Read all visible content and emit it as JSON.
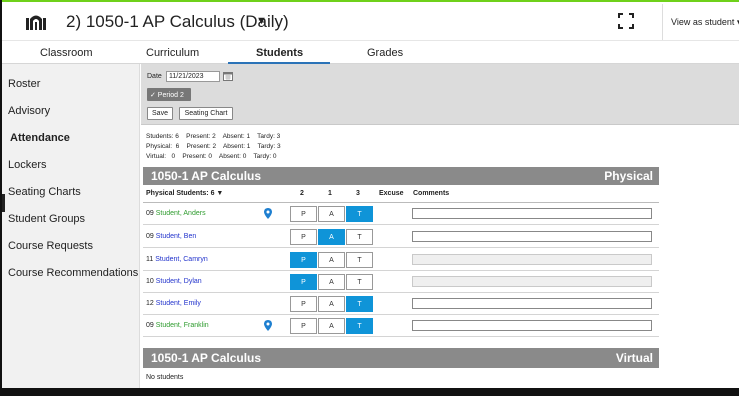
{
  "header": {
    "title": "2) 1050-1 AP Calculus (Daily)",
    "view_as": "View as student",
    "icons": {
      "logo": "campus-logo-icon",
      "title_caret": "caret-down-icon",
      "expand": "expand-icon"
    }
  },
  "tabs": [
    {
      "label": "Classroom"
    },
    {
      "label": "Curriculum"
    },
    {
      "label": "Students",
      "active": true
    },
    {
      "label": "Grades"
    }
  ],
  "sidebar": {
    "items": [
      {
        "label": "Roster"
      },
      {
        "label": "Advisory"
      },
      {
        "label": "Attendance",
        "active": true
      },
      {
        "label": "Lockers"
      },
      {
        "label": "Seating Charts"
      },
      {
        "label": "Student Groups"
      },
      {
        "label": "Course Requests"
      },
      {
        "label": "Course Recommendations"
      }
    ]
  },
  "toolbar": {
    "date_label": "Date",
    "date_value": "11/21/2023",
    "period_label": "✓ Period 2",
    "save_label": "Save",
    "seating_chart_label": "Seating Chart"
  },
  "counts": {
    "line1": "Students: 6    Present: 2    Absent: 1    Tardy: 3",
    "line2": "Physical:  6    Present: 2    Absent: 1    Tardy: 3",
    "line3": "Virtual:   0    Present: 0    Absent: 0    Tardy: 0"
  },
  "physical_section": {
    "name": "1050-1 AP Calculus",
    "kind": "Physical",
    "column_students": "Physical Students: 6 ▼",
    "columns": [
      "2",
      "1",
      "3",
      "Excuse",
      "Comments"
    ],
    "buttons": [
      "P",
      "A",
      "T"
    ]
  },
  "students": [
    {
      "num": "09",
      "name": "Student, Anders",
      "name_color": "#2e9b2e",
      "pin": true,
      "selected": "T",
      "comment_enabled": true
    },
    {
      "num": "09",
      "name": "Student, Ben",
      "name_color": "#2233cc",
      "pin": false,
      "selected": "A",
      "comment_enabled": true
    },
    {
      "num": "11",
      "name": "Student, Camryn",
      "name_color": "#2233cc",
      "pin": false,
      "selected": "P",
      "comment_enabled": false
    },
    {
      "num": "10",
      "name": "Student, Dylan",
      "name_color": "#2233cc",
      "pin": false,
      "selected": "P",
      "comment_enabled": false
    },
    {
      "num": "12",
      "name": "Student, Emily",
      "name_color": "#2233cc",
      "pin": false,
      "selected": "T",
      "comment_enabled": true
    },
    {
      "num": "09",
      "name": "Student, Franklin",
      "name_color": "#2e9b2e",
      "pin": true,
      "selected": "T",
      "comment_enabled": true
    }
  ],
  "virtual_section": {
    "name": "1050-1 AP Calculus",
    "kind": "Virtual",
    "empty_text": "No students"
  },
  "colors": {
    "accent": "#0f94d8",
    "tab_underline": "#2b73b8",
    "section_header": "#8a8a8a",
    "frame_green": "#6fd11a"
  }
}
